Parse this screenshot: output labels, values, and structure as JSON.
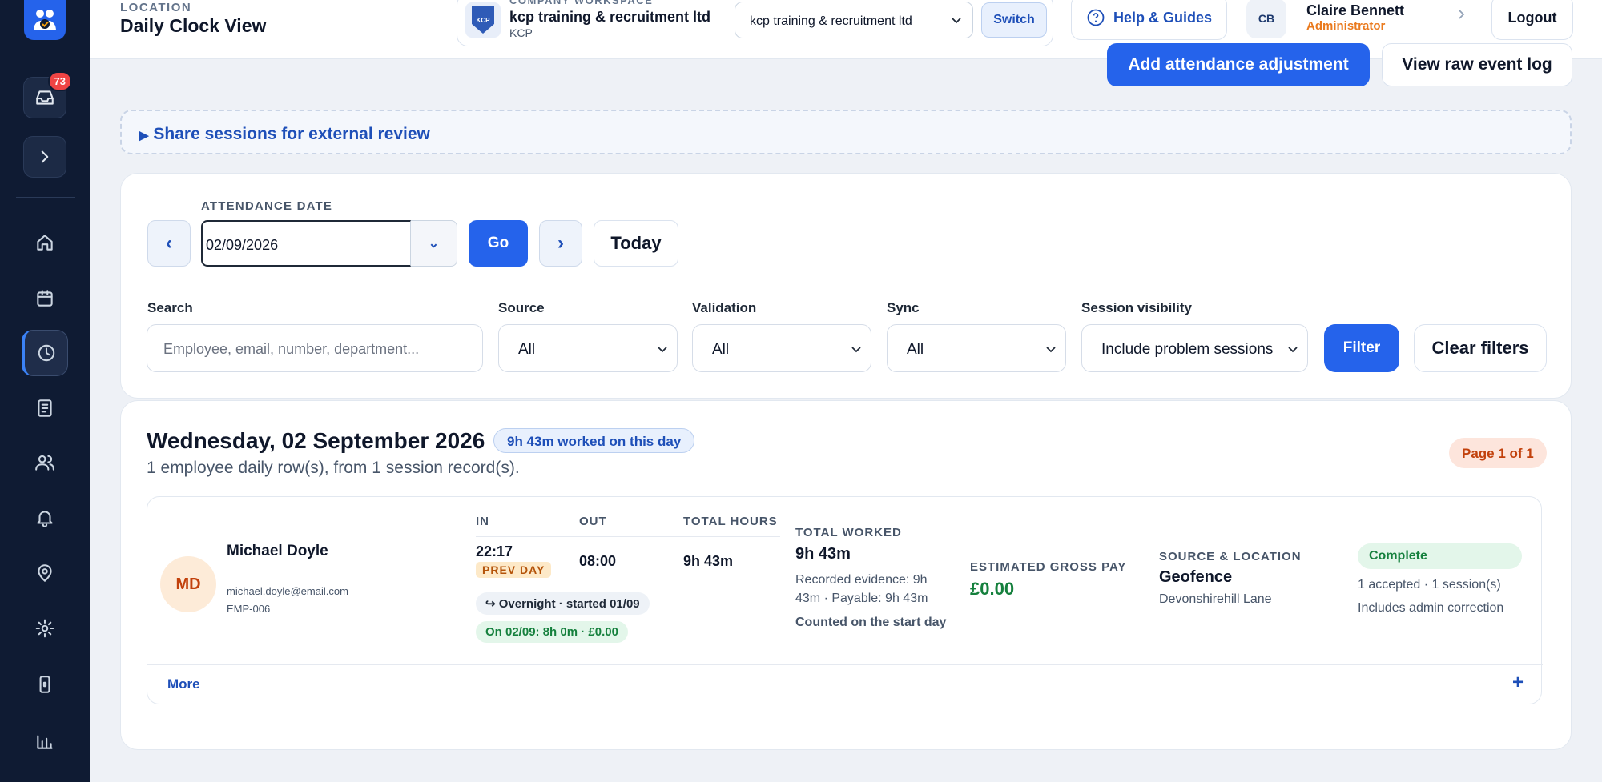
{
  "sidebar": {
    "inbox_badge": "73",
    "nav": [
      "home",
      "calendar",
      "clock",
      "document",
      "users",
      "bell",
      "location",
      "settings",
      "device",
      "reports"
    ]
  },
  "topbar": {
    "location_label": "LOCATION",
    "location_title": "Daily Clock View",
    "workspace": {
      "label": "COMPANY WORKSPACE",
      "name": "kcp training & recruitment ltd",
      "code": "KCP",
      "logo_text": "KCP",
      "selected": "kcp training & recruitment ltd",
      "switch_label": "Switch"
    },
    "help_label": "Help & Guides",
    "user": {
      "initials": "CB",
      "name": "Claire Bennett",
      "role": "Administrator"
    },
    "logout_label": "Logout"
  },
  "header": {
    "add_adjustment_label": "Add attendance adjustment",
    "raw_log_label": "View raw event log"
  },
  "share": {
    "label": "Share sessions for external review"
  },
  "filters": {
    "date_label": "ATTENDANCE DATE",
    "prev_label": "‹",
    "next_label": "›",
    "date_value": "02/09/2026",
    "date_drop": "⌄",
    "go_label": "Go",
    "today_label": "Today",
    "search_label": "Search",
    "search_placeholder": "Employee, email, number, department...",
    "source_label": "Source",
    "source_value": "All",
    "validation_label": "Validation",
    "validation_value": "All",
    "sync_label": "Sync",
    "sync_value": "All",
    "visibility_label": "Session visibility",
    "visibility_value": "Include problem sessions",
    "filter_label": "Filter",
    "clear_label": "Clear filters"
  },
  "day": {
    "title": "Wednesday, 02 September 2026",
    "worked_pill": "9h 43m worked on this day",
    "subtitle": "1 employee daily row(s), from 1 session record(s).",
    "page_pill": "Page 1 of 1"
  },
  "rows": [
    {
      "initials": "MD",
      "name": "Michael Doyle",
      "email": "michael.doyle@email.com",
      "emp_id": "EMP-006",
      "in_header": "IN",
      "out_header": "OUT",
      "total_header": "TOTAL HOURS",
      "in": "22:17",
      "prev_day": "PREV DAY",
      "out": "08:00",
      "total": "9h 43m",
      "overnight": "↪ Overnight · started 01/09",
      "on_day": "On 02/09: 8h 0m · £0.00",
      "worked_header": "TOTAL WORKED",
      "worked": "9h 43m",
      "evidence": "Recorded evidence: 9h 43m · Payable: 9h 43m",
      "counted": "Counted on the start day",
      "pay_header": "ESTIMATED GROSS PAY",
      "pay": "£0.00",
      "source_header": "SOURCE & LOCATION",
      "source": "Geofence",
      "location": "Devonshirehill Lane",
      "status": "Complete",
      "status_a": "1 accepted · 1 session(s)",
      "status_b": "Includes admin correction",
      "more_label": "More",
      "expand_label": "+"
    }
  ],
  "colors": {
    "primary": "#2563eb",
    "sidebar": "#0f1b33",
    "success": "#15803d",
    "warning": "#ea7a1e",
    "danger": "#ef4444"
  }
}
